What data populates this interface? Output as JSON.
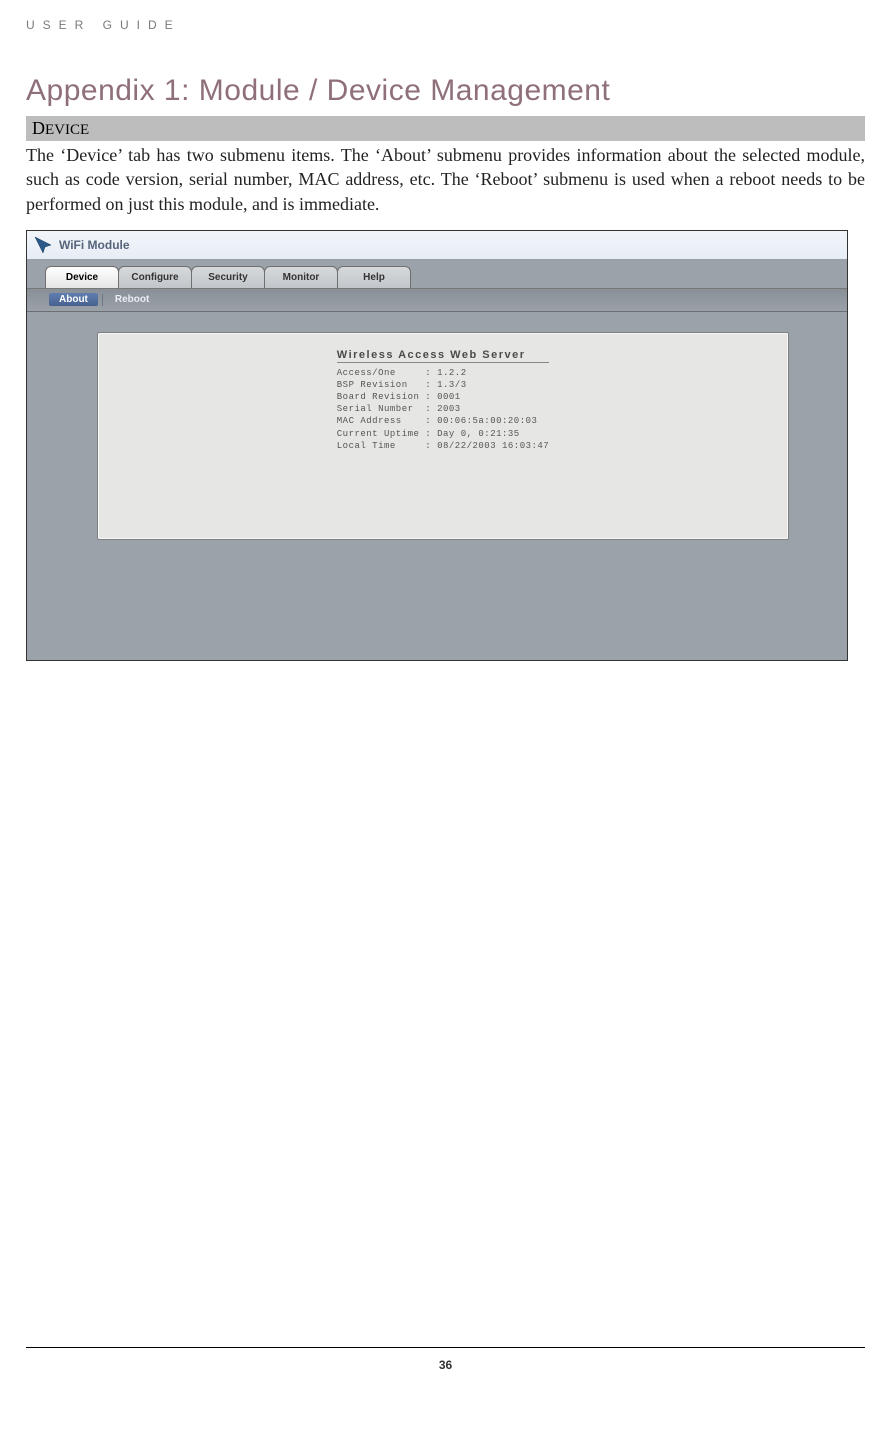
{
  "running_head": "USER GUIDE",
  "title": "Appendix 1: Module / Device Management",
  "section_label_first": "D",
  "section_label_rest": "EVICE",
  "paragraph": "The ‘Device’ tab has two submenu items. The ‘About’ submenu provides information about the selected module, such as code version, serial number, MAC address, etc. The ‘Reboot’ submenu is used when a reboot needs to be performed on just this module, and is immediate.",
  "page_number": "36",
  "screenshot": {
    "window_title": "WiFi Module",
    "tabs": [
      {
        "label": "Device",
        "active": true
      },
      {
        "label": "Configure",
        "active": false
      },
      {
        "label": "Security",
        "active": false
      },
      {
        "label": "Monitor",
        "active": false
      },
      {
        "label": "Help",
        "active": false
      }
    ],
    "subtabs": [
      {
        "label": "About",
        "active": true
      },
      {
        "label": "Reboot",
        "active": false
      }
    ],
    "about": {
      "heading": "Wireless Access Web Server",
      "rows": [
        {
          "key": "Access/One",
          "value": "1.2.2"
        },
        {
          "key": "BSP Revision",
          "value": "1.3/3"
        },
        {
          "key": "Board Revision",
          "value": "0001"
        },
        {
          "key": "Serial Number",
          "value": "2003"
        },
        {
          "key": "MAC Address",
          "value": "00:06:5a:00:20:03"
        },
        {
          "key": "Current Uptime",
          "value": "Day 0, 0:21:35"
        },
        {
          "key": "Local Time",
          "value": "08/22/2003 16:03:47"
        }
      ]
    }
  }
}
